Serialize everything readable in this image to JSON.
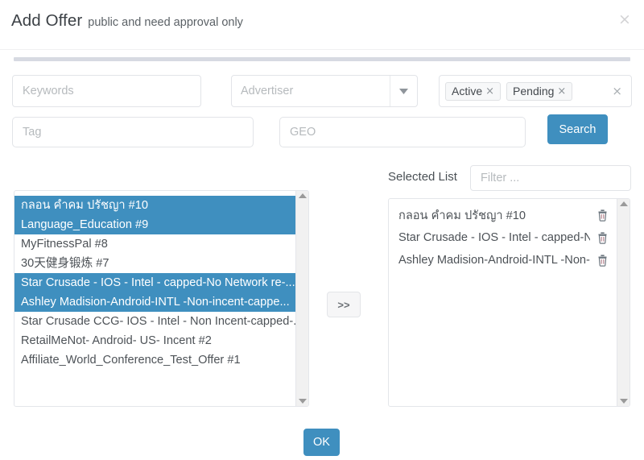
{
  "dialog": {
    "title": "Add Offer",
    "subtitle": "public and need approval only",
    "close_label": "×"
  },
  "filters": {
    "keywords_placeholder": "Keywords",
    "advertiser_label": "Advertiser",
    "dropdown_icon": "chevron-down-icon",
    "status_pills": [
      {
        "label": "Active",
        "remove": "×"
      },
      {
        "label": "Pending",
        "remove": "×"
      }
    ],
    "clear_all": "×",
    "tag_placeholder": "Tag",
    "geo_placeholder": "GEO",
    "search_label": "Search"
  },
  "available": {
    "items": [
      {
        "label": "กลอน คำคม ปรัชญา #10",
        "selected": true
      },
      {
        "label": "Language_Education #9",
        "selected": true
      },
      {
        "label": "MyFitnessPal #8",
        "selected": false
      },
      {
        "label": "30天健身锻炼 #7",
        "selected": false
      },
      {
        "label": "Star Crusade - IOS - Intel - capped-No Network re-...",
        "selected": true
      },
      {
        "label": "Ashley Madision-Android-INTL -Non-incent-cappe...",
        "selected": true
      },
      {
        "label": "Star Crusade CCG- IOS - Intel - Non Incent-capped-...",
        "selected": false
      },
      {
        "label": "RetailMeNot- Android- US- Incent #2",
        "selected": false
      },
      {
        "label": "Affiliate_World_Conference_Test_Offer #1",
        "selected": false
      }
    ]
  },
  "transfer": {
    "label": ">>"
  },
  "selected": {
    "title": "Selected List",
    "filter_placeholder": "Filter ...",
    "items": [
      {
        "label": "กลอน คำคม ปรัชญา #10"
      },
      {
        "label": "Star Crusade - IOS - Intel - capped-No"
      },
      {
        "label": "Ashley Madision-Android-INTL -Non-ir"
      }
    ],
    "remove_icon": "trash-icon"
  },
  "footer": {
    "ok_label": "OK"
  },
  "colors": {
    "accent": "#3f8fbf",
    "divider": "#d7dae2",
    "border": "#e2e4e8",
    "text": "#4d5257",
    "placeholder": "#b6babd"
  }
}
